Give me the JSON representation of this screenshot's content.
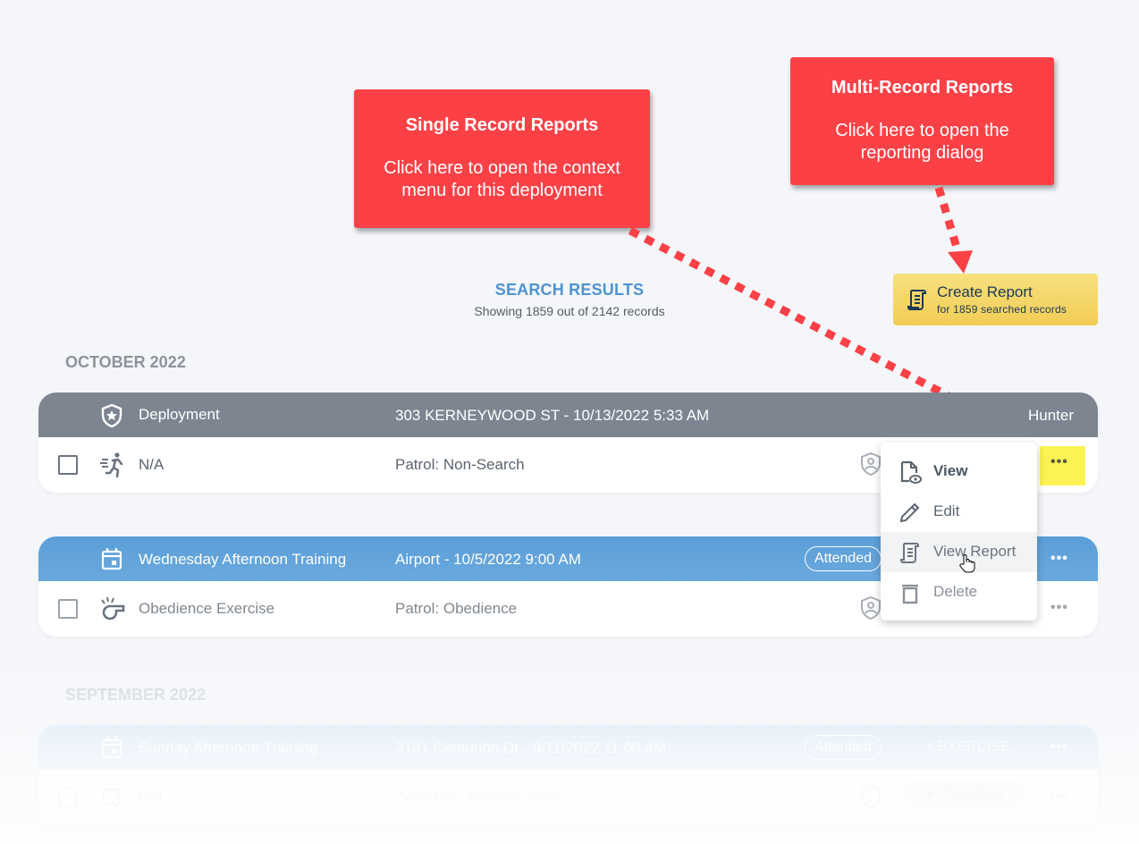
{
  "callouts": {
    "single": {
      "title": "Single Record Reports",
      "body_line1": "Click here to open the context",
      "body_line2": "menu for this deployment"
    },
    "multi": {
      "title": "Multi-Record Reports",
      "body_line1": "Click here to open the",
      "body_line2": "reporting dialog"
    }
  },
  "search": {
    "title": "SEARCH RESULTS",
    "subtitle": "Showing 1859 out of 2142 records",
    "shown": 1859,
    "total": 2142
  },
  "create_report": {
    "title": "Create Report",
    "subtitle": "for 1859 searched records",
    "icon": "scroll-report-icon"
  },
  "groups": [
    {
      "month": "OCTOBER 2022",
      "records": [
        {
          "type": "deployment",
          "header_color": "#7d8591",
          "header_icon": "shield-star-icon",
          "title": "Deployment",
          "location": "303 KERNEYWOOD ST - 10/13/2022 5:33 AM",
          "assignee": "Hunter",
          "row": {
            "icon": "running-person-icon",
            "name": "N/A",
            "category": "Patrol: Non-Search"
          }
        },
        {
          "type": "training",
          "header_color": "#5ea0d8",
          "header_icon": "calendar-icon",
          "title": "Wednesday Afternoon Training",
          "location": "Airport - 10/5/2022 9:00 AM",
          "status": "Attended",
          "row": {
            "icon": "whistle-icon",
            "name": "Obedience Exercise",
            "category": "Patrol: Obedience"
          }
        }
      ]
    },
    {
      "month": "SEPTEMBER 2022",
      "records": [
        {
          "type": "training",
          "header_color": "#d3e5f5",
          "header_icon": "calendar-icon",
          "title": "Sunday Afternoon Training",
          "location": "3131 Centurion Dr - 9/11/2022 11:00 AM",
          "status": "Attended",
          "action": "+ EXERCISE",
          "row": {
            "icon": "briefcase-search-icon",
            "name": "test",
            "category": "Detection: Proofing Only",
            "status": "Complete"
          }
        }
      ]
    }
  ],
  "context_menu": {
    "items": [
      {
        "label": "View",
        "icon": "file-eye-icon"
      },
      {
        "label": "Edit",
        "icon": "pencil-icon"
      },
      {
        "label": "View Report",
        "icon": "scroll-report-icon",
        "hovered": true
      },
      {
        "label": "Delete",
        "icon": "trash-icon"
      }
    ]
  },
  "colors": {
    "callout": "#fb4146",
    "accent_blue": "#4f93d1",
    "highlight_yellow": "#fbf253",
    "report_button": "#f4d466"
  }
}
